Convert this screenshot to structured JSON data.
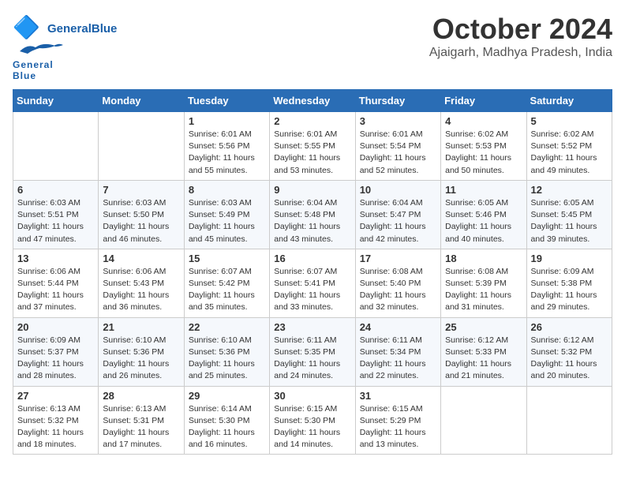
{
  "header": {
    "logo_general": "General",
    "logo_blue": "Blue",
    "month": "October 2024",
    "location": "Ajaigarh, Madhya Pradesh, India"
  },
  "weekdays": [
    "Sunday",
    "Monday",
    "Tuesday",
    "Wednesday",
    "Thursday",
    "Friday",
    "Saturday"
  ],
  "weeks": [
    [
      {
        "day": null
      },
      {
        "day": null
      },
      {
        "day": 1,
        "sunrise": "6:01 AM",
        "sunset": "5:56 PM",
        "daylight": "11 hours and 55 minutes."
      },
      {
        "day": 2,
        "sunrise": "6:01 AM",
        "sunset": "5:55 PM",
        "daylight": "11 hours and 53 minutes."
      },
      {
        "day": 3,
        "sunrise": "6:01 AM",
        "sunset": "5:54 PM",
        "daylight": "11 hours and 52 minutes."
      },
      {
        "day": 4,
        "sunrise": "6:02 AM",
        "sunset": "5:53 PM",
        "daylight": "11 hours and 50 minutes."
      },
      {
        "day": 5,
        "sunrise": "6:02 AM",
        "sunset": "5:52 PM",
        "daylight": "11 hours and 49 minutes."
      }
    ],
    [
      {
        "day": 6,
        "sunrise": "6:03 AM",
        "sunset": "5:51 PM",
        "daylight": "11 hours and 47 minutes."
      },
      {
        "day": 7,
        "sunrise": "6:03 AM",
        "sunset": "5:50 PM",
        "daylight": "11 hours and 46 minutes."
      },
      {
        "day": 8,
        "sunrise": "6:03 AM",
        "sunset": "5:49 PM",
        "daylight": "11 hours and 45 minutes."
      },
      {
        "day": 9,
        "sunrise": "6:04 AM",
        "sunset": "5:48 PM",
        "daylight": "11 hours and 43 minutes."
      },
      {
        "day": 10,
        "sunrise": "6:04 AM",
        "sunset": "5:47 PM",
        "daylight": "11 hours and 42 minutes."
      },
      {
        "day": 11,
        "sunrise": "6:05 AM",
        "sunset": "5:46 PM",
        "daylight": "11 hours and 40 minutes."
      },
      {
        "day": 12,
        "sunrise": "6:05 AM",
        "sunset": "5:45 PM",
        "daylight": "11 hours and 39 minutes."
      }
    ],
    [
      {
        "day": 13,
        "sunrise": "6:06 AM",
        "sunset": "5:44 PM",
        "daylight": "11 hours and 37 minutes."
      },
      {
        "day": 14,
        "sunrise": "6:06 AM",
        "sunset": "5:43 PM",
        "daylight": "11 hours and 36 minutes."
      },
      {
        "day": 15,
        "sunrise": "6:07 AM",
        "sunset": "5:42 PM",
        "daylight": "11 hours and 35 minutes."
      },
      {
        "day": 16,
        "sunrise": "6:07 AM",
        "sunset": "5:41 PM",
        "daylight": "11 hours and 33 minutes."
      },
      {
        "day": 17,
        "sunrise": "6:08 AM",
        "sunset": "5:40 PM",
        "daylight": "11 hours and 32 minutes."
      },
      {
        "day": 18,
        "sunrise": "6:08 AM",
        "sunset": "5:39 PM",
        "daylight": "11 hours and 31 minutes."
      },
      {
        "day": 19,
        "sunrise": "6:09 AM",
        "sunset": "5:38 PM",
        "daylight": "11 hours and 29 minutes."
      }
    ],
    [
      {
        "day": 20,
        "sunrise": "6:09 AM",
        "sunset": "5:37 PM",
        "daylight": "11 hours and 28 minutes."
      },
      {
        "day": 21,
        "sunrise": "6:10 AM",
        "sunset": "5:36 PM",
        "daylight": "11 hours and 26 minutes."
      },
      {
        "day": 22,
        "sunrise": "6:10 AM",
        "sunset": "5:36 PM",
        "daylight": "11 hours and 25 minutes."
      },
      {
        "day": 23,
        "sunrise": "6:11 AM",
        "sunset": "5:35 PM",
        "daylight": "11 hours and 24 minutes."
      },
      {
        "day": 24,
        "sunrise": "6:11 AM",
        "sunset": "5:34 PM",
        "daylight": "11 hours and 22 minutes."
      },
      {
        "day": 25,
        "sunrise": "6:12 AM",
        "sunset": "5:33 PM",
        "daylight": "11 hours and 21 minutes."
      },
      {
        "day": 26,
        "sunrise": "6:12 AM",
        "sunset": "5:32 PM",
        "daylight": "11 hours and 20 minutes."
      }
    ],
    [
      {
        "day": 27,
        "sunrise": "6:13 AM",
        "sunset": "5:32 PM",
        "daylight": "11 hours and 18 minutes."
      },
      {
        "day": 28,
        "sunrise": "6:13 AM",
        "sunset": "5:31 PM",
        "daylight": "11 hours and 17 minutes."
      },
      {
        "day": 29,
        "sunrise": "6:14 AM",
        "sunset": "5:30 PM",
        "daylight": "11 hours and 16 minutes."
      },
      {
        "day": 30,
        "sunrise": "6:15 AM",
        "sunset": "5:30 PM",
        "daylight": "11 hours and 14 minutes."
      },
      {
        "day": 31,
        "sunrise": "6:15 AM",
        "sunset": "5:29 PM",
        "daylight": "11 hours and 13 minutes."
      },
      {
        "day": null
      },
      {
        "day": null
      }
    ]
  ]
}
